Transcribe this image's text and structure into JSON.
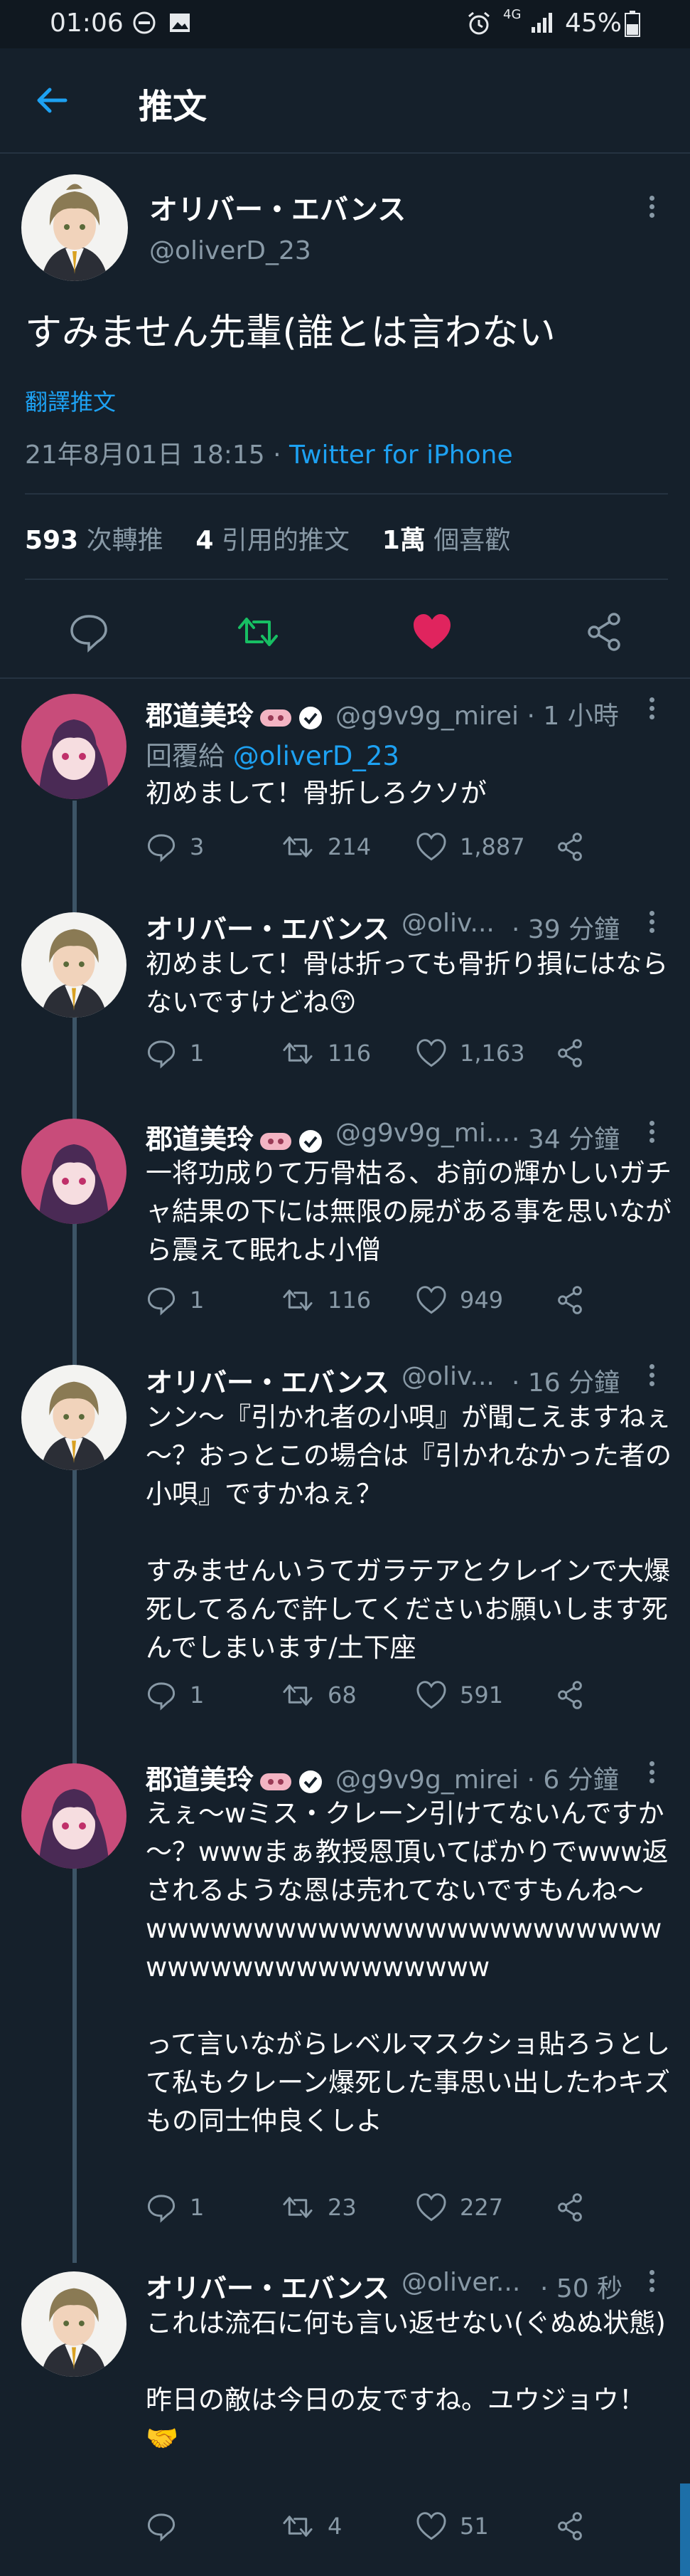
{
  "status_bar": {
    "time": "01:06",
    "network": "4G",
    "battery": "45%"
  },
  "app_bar": {
    "title": "推文"
  },
  "main_tweet": {
    "author_name": "オリバー・エバンス",
    "author_handle": "@oliverD_23",
    "text": "すみません先輩(誰とは言わない",
    "translate_label": "翻譯推文",
    "timestamp": "21年8月01日 18:15 · ",
    "source": "Twitter for iPhone",
    "stats": {
      "retweets": "593",
      "retweets_label": "次轉推",
      "quotes": "4",
      "quotes_label": "引用的推文",
      "likes": "1萬",
      "likes_label": "個喜歡"
    }
  },
  "replies": [
    {
      "author_name": "郡道美玲",
      "author_handle": "@g9v9g_mirei · 1 小時",
      "reply_prefix": "回覆給 ",
      "reply_to": "@oliverD_23",
      "text": "初めまして！骨折しろクソが",
      "replies": "3",
      "retweets": "214",
      "likes": "1,887"
    },
    {
      "author_name": "オリバー・エバンス",
      "author_handle": "@oliv...",
      "time": "· 39 分鐘",
      "text": "初めまして！骨は折っても骨折り損にはならないですけどね😙",
      "replies": "1",
      "retweets": "116",
      "likes": "1,163"
    },
    {
      "author_name": "郡道美玲",
      "author_handle": "@g9v9g_mi...",
      "time": "· 34 分鐘",
      "text": "一将功成りて万骨枯る、お前の輝かしいガチャ結果の下には無限の屍がある事を思いながら震えて眠れよ小僧",
      "replies": "1",
      "retweets": "116",
      "likes": "949"
    },
    {
      "author_name": "オリバー・エバンス",
      "author_handle": "@oliv...",
      "time": "· 16 分鐘",
      "text": "ンン～『引かれ者の小唄』が聞こえますねぇ～？おっとこの場合は『引かれなかった者の小唄』ですかねぇ？\n\nすみませんいうてガラテアとクレインで大爆死してるんで許してくださいお願いします死んでしまいます/土下座",
      "replies": "1",
      "retweets": "68",
      "likes": "591"
    },
    {
      "author_name": "郡道美玲",
      "author_handle": "@g9v9g_mirei · 6 分鐘",
      "text": "えぇ～wミス・クレーン引けてないんですか～？wwwまぁ教授恩頂いてばかりでwww返されるような恩は売れてないですもんね～\nwwwwwwwwwwwwwwwwwwwwwwwwwwwwwwwwwwwwwwww\n\nって言いながらレベルマスクショ貼ろうとして私もクレーン爆死した事思い出したわキズもの同士仲良くしよ",
      "replies": "1",
      "retweets": "23",
      "likes": "227"
    },
    {
      "author_name": "オリバー・エバンス",
      "author_handle": "@oliver...",
      "time": "· 50 秒",
      "text": "これは流石に何も言い返せない(ぐぬぬ状態)\n\n昨日の敵は今日の友ですね。ユウジョウ！🤝",
      "replies": "",
      "retweets": "4",
      "likes": "51"
    }
  ],
  "colors": {
    "background": "#15202b",
    "accent": "#1da1f2",
    "retweet_active": "#17bf63",
    "like_active": "#e0245e",
    "muted": "#8899a6"
  },
  "icons": [
    "back-arrow-icon",
    "reply-icon",
    "retweet-icon",
    "heart-icon",
    "share-icon",
    "more-icon",
    "verified-icon"
  ]
}
